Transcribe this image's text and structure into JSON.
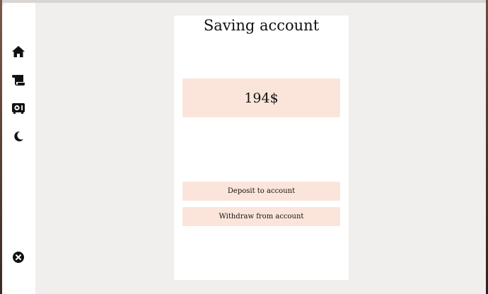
{
  "sidebar": {
    "items": [
      {
        "icon": "home-icon"
      },
      {
        "icon": "scroll-icon"
      },
      {
        "icon": "safe-icon"
      },
      {
        "icon": "moon-icon"
      }
    ],
    "close_icon": "close-icon"
  },
  "panel": {
    "title": "Saving account",
    "balance": "194$",
    "deposit_label": "Deposit to account",
    "withdraw_label": "Withdraw from account"
  },
  "colors": {
    "background": "#f1efed",
    "panel": "#ffffff",
    "accent_box": "#fbe5da",
    "text": "#111111"
  }
}
